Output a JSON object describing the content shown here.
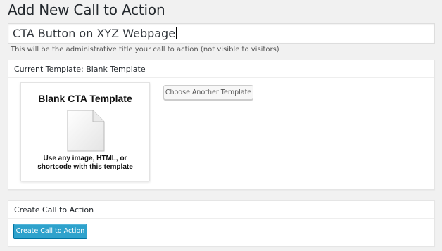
{
  "page": {
    "title": "Add New Call to Action"
  },
  "title_field": {
    "value": "CTA Button on XYZ Webpage",
    "help": "This will be the administrative title your call to action (not visible to visitors)"
  },
  "template_box": {
    "heading": "Current Template: Blank Template",
    "card_title": "Blank CTA Template",
    "card_desc_line1": "Use any image, HTML, or",
    "card_desc_line2": "shortcode with this template",
    "choose_button": "Choose Another Template",
    "icon": "document-icon"
  },
  "create_box": {
    "heading": "Create Call to Action",
    "button": "Create Call to Action"
  },
  "colors": {
    "primary_button": "#2ea2cc",
    "primary_border": "#0074a2",
    "background": "#f1f1f1"
  }
}
